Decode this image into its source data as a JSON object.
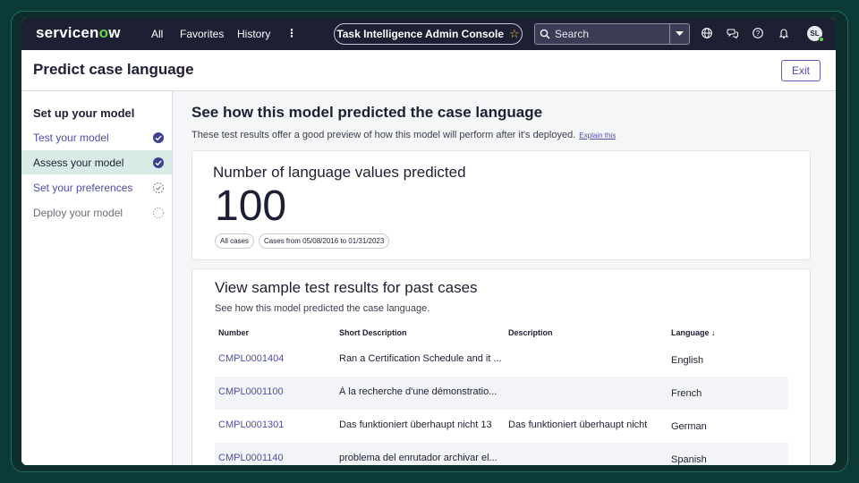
{
  "nav": {
    "logo_prefix": "servicen",
    "logo_o": "o",
    "logo_suffix": "w",
    "all": "All",
    "favorites": "Favorites",
    "history": "History",
    "more": "⋮",
    "workspace": "Task Intelligence Admin Console",
    "star": "☆",
    "search_placeholder": "Search",
    "avatar": "SL"
  },
  "page": {
    "title": "Predict case language",
    "exit": "Exit"
  },
  "sidebar": {
    "title": "Set up your model",
    "steps": [
      {
        "label": "Test your model",
        "status": "complete"
      },
      {
        "label": "Assess your model",
        "status": "complete"
      },
      {
        "label": "Set your preferences",
        "status": "in-progress"
      },
      {
        "label": "Deploy your model",
        "status": "not-started"
      }
    ]
  },
  "main": {
    "title": "See how this model predicted the case language",
    "subtitle": "These test results offer a good preview of how this model will perform after it's deployed.",
    "explain_link": "Explain this",
    "count_card": {
      "title": "Number of language values predicted",
      "value": "100",
      "chips": [
        "All cases",
        "Cases from 05/08/2016 to 01/31/2023"
      ]
    },
    "results": {
      "title": "View sample test results for past cases",
      "subtitle": "See how this model predicted the case language.",
      "columns": [
        "Number",
        "Short Description",
        "Description",
        "Language ↓"
      ],
      "rows": [
        {
          "number": "CMPL0001404",
          "short": "Ran a Certification Schedule and it ...",
          "desc": "",
          "lang": "English"
        },
        {
          "number": "CMPL0001100",
          "short": "À la recherche d'une démonstratio...",
          "desc": "",
          "lang": "French"
        },
        {
          "number": "CMPL0001301",
          "short": "Das funktioniert überhaupt nicht 13",
          "desc": "Das funktioniert überhaupt nicht",
          "lang": "German"
        },
        {
          "number": "CMPL0001140",
          "short": "problema del enrutador archivar el...",
          "desc": "",
          "lang": "Spanish"
        }
      ]
    }
  },
  "colors": {
    "nav_bg": "#1d1f33",
    "accent": "#4c4ea8",
    "active_step": "#d8ebe6",
    "brand_green": "#62d84e"
  }
}
